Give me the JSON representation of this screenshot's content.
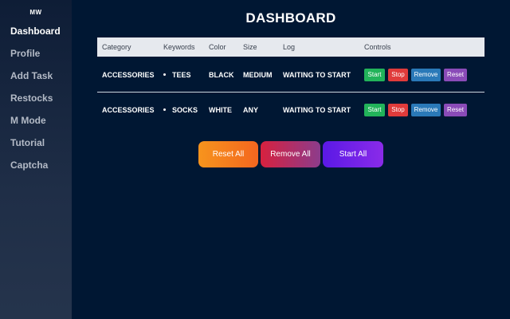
{
  "sidebar": {
    "brand": "MW",
    "items": [
      {
        "label": "Dashboard",
        "active": true
      },
      {
        "label": "Profile"
      },
      {
        "label": "Add Task"
      },
      {
        "label": "Restocks"
      },
      {
        "label": "M Mode"
      },
      {
        "label": "Tutorial"
      },
      {
        "label": "Captcha"
      }
    ]
  },
  "main": {
    "title": "DASHBOARD",
    "table": {
      "headers": [
        "Category",
        "Keywords",
        "Color",
        "Size",
        "Log",
        "Controls"
      ],
      "rows": [
        {
          "category": "ACCESSORIES",
          "keyword": "TEES",
          "color": "BLACK",
          "size": "MEDIUM",
          "log": "WAITING TO START"
        },
        {
          "category": "ACCESSORIES",
          "keyword": "SOCKS",
          "color": "WHITE",
          "size": "ANY",
          "log": "WAITING TO START"
        }
      ],
      "controls": {
        "start": "Start",
        "stop": "Stop",
        "remove": "Remove",
        "reset": "Reset"
      }
    },
    "actions": {
      "reset_all": "Reset All",
      "remove_all": "Remove All",
      "start_all": "Start All"
    }
  },
  "colors": {
    "background": "#001733",
    "start": "#22b35a",
    "stop": "#e03b3b",
    "remove": "#2a79b8",
    "reset": "#8a4bb8"
  }
}
